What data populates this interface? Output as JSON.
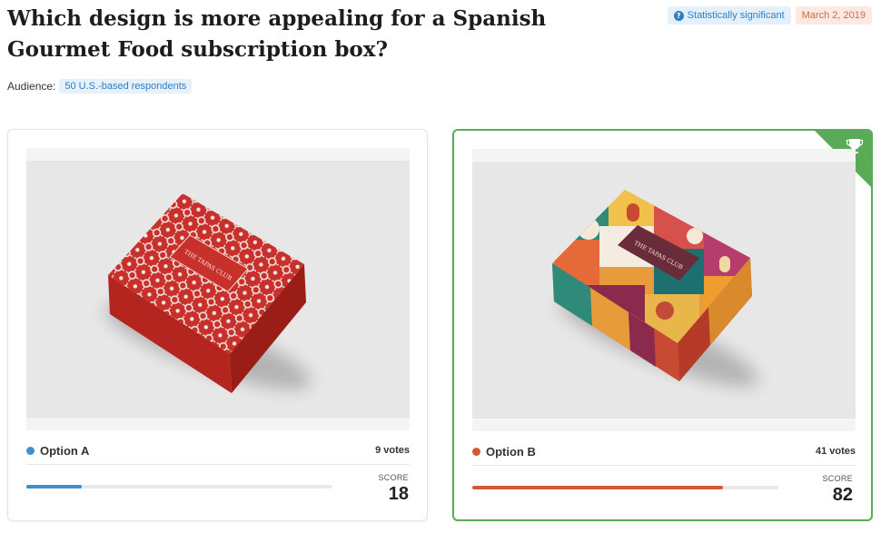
{
  "question": "Which design is more appealing for a Spanish Gourmet Food subscription box?",
  "badges": {
    "significance": "Statistically significant",
    "significance_icon": "question-circle-icon",
    "date": "March 2, 2019"
  },
  "audience": {
    "label": "Audience:",
    "value": "50 U.S.-based respondents"
  },
  "options": [
    {
      "label": "Option A",
      "votes": "9 votes",
      "score_label": "SCORE",
      "score": "18",
      "score_fraction": 0.18,
      "color": "#3d8fd0",
      "box_text": "THE TAPAS CLUB",
      "winner": false
    },
    {
      "label": "Option B",
      "votes": "41 votes",
      "score_label": "SCORE",
      "score": "82",
      "score_fraction": 0.82,
      "color": "#d05a36",
      "box_text": "THE TAPAS CLUB",
      "winner": true,
      "winner_icon": "trophy-icon"
    }
  ],
  "colors": {
    "winner_green": "#5aab57",
    "box_a_red": "#c8302c",
    "significance_blue": "#2d7fc4",
    "date_orange": "#d36a47"
  }
}
